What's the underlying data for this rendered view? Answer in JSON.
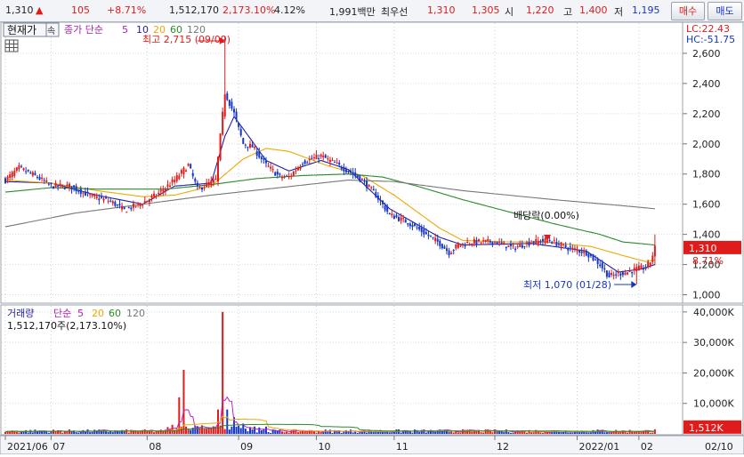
{
  "toolbar": {
    "price": "1,310",
    "up_arrow": "▲",
    "change": "105",
    "change_pct": "+8.71%",
    "volume": "1,512,170",
    "volume_ratio": "2,173.10%",
    "turnover": "4.12%",
    "amount": "1,991백만",
    "bid_label": "최우선",
    "best_ask": "1,310",
    "best_bid": "1,305",
    "open_label": "시",
    "open": "1,220",
    "high_label": "고",
    "high": "1,400",
    "low_label": "저",
    "low": "1,195",
    "buy_label": "매수",
    "sell_label": "매도"
  },
  "colors": {
    "up": "#e01b1b",
    "down": "#1636c8",
    "ma5": "#1f1fa8",
    "ma20": "#f0a800",
    "ma60": "#2a8a2a",
    "ma120": "#777777",
    "vol_ma5": "#c020c0"
  },
  "chart_data": [
    {
      "type": "candlestick",
      "panel": "price",
      "title": "현재가",
      "legend": {
        "ma_label": "종가 단순",
        "periods": [
          "5",
          "10",
          "20",
          "60",
          "120"
        ]
      },
      "ylim": [
        950,
        2800
      ],
      "y_ticks": [
        "2,600",
        "2,400",
        "2,200",
        "2,000",
        "1,800",
        "1,600",
        "1,400",
        "1,200",
        "1,000"
      ],
      "y_tick_values": [
        2600,
        2400,
        2200,
        2000,
        1800,
        1600,
        1400,
        1200,
        1000
      ],
      "x_ticks": [
        "2021/06",
        "07",
        "08",
        "09",
        "10",
        "11",
        "12",
        "2022/01",
        "02",
        "02/10"
      ],
      "annotations": {
        "high": "최고 2,715 (09/09)",
        "low": "최저 1,070 (01/28)",
        "dividend": "배당락(0.00%)"
      },
      "side_labels": {
        "lc": "LC:22.43",
        "hc": "HC:-51.75",
        "last": "1,310",
        "last_pct": "8.71%"
      },
      "close_keypoints": [
        [
          0,
          1760
        ],
        [
          6,
          1840
        ],
        [
          14,
          1780
        ],
        [
          20,
          1720
        ],
        [
          28,
          1720
        ],
        [
          38,
          1650
        ],
        [
          46,
          1620
        ],
        [
          52,
          1560
        ],
        [
          60,
          1610
        ],
        [
          66,
          1660
        ],
        [
          74,
          1760
        ],
        [
          80,
          1860
        ],
        [
          84,
          1700
        ],
        [
          92,
          1760
        ],
        [
          96,
          2340
        ],
        [
          100,
          2200
        ],
        [
          104,
          2000
        ],
        [
          108,
          1980
        ],
        [
          114,
          1860
        ],
        [
          120,
          1780
        ],
        [
          124,
          1780
        ],
        [
          130,
          1880
        ],
        [
          138,
          1920
        ],
        [
          144,
          1870
        ],
        [
          150,
          1820
        ],
        [
          156,
          1760
        ],
        [
          162,
          1660
        ],
        [
          168,
          1530
        ],
        [
          176,
          1480
        ],
        [
          182,
          1420
        ],
        [
          190,
          1340
        ],
        [
          194,
          1280
        ],
        [
          198,
          1330
        ],
        [
          204,
          1350
        ],
        [
          214,
          1350
        ],
        [
          222,
          1310
        ],
        [
          230,
          1350
        ],
        [
          238,
          1360
        ],
        [
          246,
          1310
        ],
        [
          254,
          1280
        ],
        [
          260,
          1200
        ],
        [
          264,
          1120
        ],
        [
          268,
          1140
        ],
        [
          272,
          1150
        ],
        [
          276,
          1170
        ],
        [
          280,
          1180
        ],
        [
          282,
          1220
        ],
        [
          284,
          1310
        ]
      ],
      "ma_keypoints": {
        "ma5": [
          [
            0,
            1750
          ],
          [
            20,
            1740
          ],
          [
            40,
            1660
          ],
          [
            60,
            1600
          ],
          [
            74,
            1720
          ],
          [
            90,
            1740
          ],
          [
            96,
            2050
          ],
          [
            100,
            2180
          ],
          [
            104,
            2100
          ],
          [
            114,
            1890
          ],
          [
            124,
            1820
          ],
          [
            138,
            1890
          ],
          [
            150,
            1830
          ],
          [
            168,
            1570
          ],
          [
            190,
            1380
          ],
          [
            200,
            1330
          ],
          [
            230,
            1340
          ],
          [
            254,
            1290
          ],
          [
            268,
            1150
          ],
          [
            278,
            1170
          ],
          [
            284,
            1200
          ]
        ],
        "ma20": [
          [
            0,
            1760
          ],
          [
            20,
            1740
          ],
          [
            40,
            1690
          ],
          [
            60,
            1650
          ],
          [
            74,
            1660
          ],
          [
            90,
            1720
          ],
          [
            104,
            1900
          ],
          [
            114,
            1970
          ],
          [
            124,
            1950
          ],
          [
            140,
            1860
          ],
          [
            156,
            1790
          ],
          [
            170,
            1660
          ],
          [
            190,
            1440
          ],
          [
            200,
            1360
          ],
          [
            220,
            1350
          ],
          [
            236,
            1350
          ],
          [
            256,
            1320
          ],
          [
            270,
            1260
          ],
          [
            280,
            1220
          ],
          [
            284,
            1230
          ]
        ],
        "ma60": [
          [
            0,
            1680
          ],
          [
            20,
            1710
          ],
          [
            40,
            1700
          ],
          [
            70,
            1700
          ],
          [
            90,
            1730
          ],
          [
            110,
            1770
          ],
          [
            130,
            1790
          ],
          [
            150,
            1800
          ],
          [
            165,
            1780
          ],
          [
            180,
            1720
          ],
          [
            200,
            1630
          ],
          [
            220,
            1550
          ],
          [
            240,
            1470
          ],
          [
            260,
            1400
          ],
          [
            270,
            1350
          ],
          [
            284,
            1330
          ]
        ],
        "ma120": [
          [
            0,
            1450
          ],
          [
            30,
            1540
          ],
          [
            60,
            1600
          ],
          [
            90,
            1660
          ],
          [
            120,
            1710
          ],
          [
            150,
            1760
          ],
          [
            170,
            1750
          ],
          [
            200,
            1690
          ],
          [
            240,
            1630
          ],
          [
            270,
            1590
          ],
          [
            284,
            1570
          ]
        ]
      }
    },
    {
      "type": "bar",
      "panel": "volume",
      "title": "거래량",
      "legend": {
        "ma_label": "단순",
        "periods": [
          "5",
          "20",
          "60",
          "120"
        ]
      },
      "value_label": "1,512,170주(2,173.10%)",
      "ylim": [
        0,
        42000000
      ],
      "y_ticks": [
        "40,000K",
        "30,000K",
        "20,000K",
        "10,000K"
      ],
      "y_tick_values": [
        40000000,
        30000000,
        20000000,
        10000000
      ],
      "side_labels": {
        "last": "1,512K",
        "last_pct": "2173.10%"
      },
      "spikes": [
        [
          76,
          12000000
        ],
        [
          78,
          21000000
        ],
        [
          93,
          8000000
        ],
        [
          95,
          40000000
        ],
        [
          97,
          8000000
        ],
        [
          100,
          5500000
        ]
      ]
    }
  ]
}
